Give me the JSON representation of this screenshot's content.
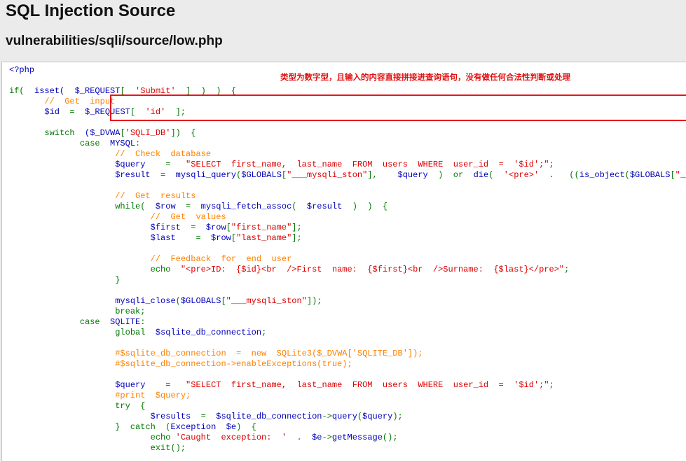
{
  "page": {
    "title": "SQL Injection Source",
    "subtitle": "vulnerabilities/sqli/source/low.php"
  },
  "annotation": {
    "text": "类型为数字型，且输入的内容直接拼接进查询语句，没有做任何合法性判断或处理",
    "color": "#e01010"
  },
  "highlight": {
    "border_color": "#e4151c"
  },
  "colors": {
    "default": "#0000bb",
    "string": "#dd0000",
    "keyword": "#007700",
    "comment": "#ff8000"
  },
  "code_lines": [
    [
      [
        "def",
        "<?php"
      ]
    ],
    [],
    [
      [
        "kw",
        "if( "
      ],
      [
        "def",
        " isset( "
      ],
      [
        "kw",
        " "
      ],
      [
        "def",
        "$_REQUEST"
      ],
      [
        "kw",
        "[ "
      ],
      [
        "str",
        " 'Submit' "
      ],
      [
        "kw",
        " ]  )  )  {"
      ]
    ],
    [
      [
        "cmt",
        "       //  Get  input"
      ]
    ],
    [
      [
        "def",
        "       $id "
      ],
      [
        "kw",
        " = "
      ],
      [
        "def",
        " $_REQUEST"
      ],
      [
        "kw",
        "[ "
      ],
      [
        "str",
        " 'id' "
      ],
      [
        "kw",
        " ];"
      ]
    ],
    [],
    [
      [
        "kw",
        "       switch "
      ],
      [
        "def",
        " ($_DVWA"
      ],
      [
        "kw",
        "["
      ],
      [
        "str",
        "'SQLI_DB'"
      ],
      [
        "kw",
        "]) "
      ],
      [
        "kw",
        " {"
      ]
    ],
    [
      [
        "kw",
        "              case "
      ],
      [
        "def",
        " MYSQL"
      ],
      [
        "kw",
        ":"
      ]
    ],
    [
      [
        "cmt",
        "                     //  Check  database"
      ]
    ],
    [
      [
        "def",
        "                     $query "
      ],
      [
        "kw",
        "   = "
      ],
      [
        "str",
        "  \"SELECT  first_name,  last_name  FROM  users  WHERE  user_id  =  '$id';\""
      ],
      [
        "kw",
        ";"
      ]
    ],
    [
      [
        "def",
        "                     $result "
      ],
      [
        "kw",
        " = "
      ],
      [
        "def",
        " mysqli_query"
      ],
      [
        "kw",
        "("
      ],
      [
        "def",
        "$GLOBALS"
      ],
      [
        "kw",
        "["
      ],
      [
        "str",
        "\"___mysqli_ston\""
      ],
      [
        "kw",
        "],    "
      ],
      [
        "def",
        "$query "
      ],
      [
        "kw",
        " ) "
      ],
      [
        "kw",
        " or "
      ],
      [
        "def",
        " die"
      ],
      [
        "kw",
        "( "
      ],
      [
        "str",
        " '<pre>' "
      ],
      [
        "kw",
        " . "
      ],
      [
        "kw",
        "  (("
      ],
      [
        "def",
        "is_object"
      ],
      [
        "kw",
        "("
      ],
      [
        "def",
        "$GLOBALS"
      ],
      [
        "kw",
        "["
      ],
      [
        "str",
        "\"___mysqli_ston\""
      ],
      [
        "kw",
        "]))"
      ]
    ],
    [],
    [
      [
        "cmt",
        "                     //  Get  results"
      ]
    ],
    [
      [
        "kw",
        "                     while( "
      ],
      [
        "def",
        " $row "
      ],
      [
        "kw",
        " = "
      ],
      [
        "def",
        " mysqli_fetch_assoc"
      ],
      [
        "kw",
        "( "
      ],
      [
        "def",
        " $result "
      ],
      [
        "kw",
        " )  )  {"
      ]
    ],
    [
      [
        "cmt",
        "                            //  Get  values"
      ]
    ],
    [
      [
        "def",
        "                            $first "
      ],
      [
        "kw",
        " = "
      ],
      [
        "def",
        " $row"
      ],
      [
        "kw",
        "["
      ],
      [
        "str",
        "\"first_name\""
      ],
      [
        "kw",
        "];"
      ]
    ],
    [
      [
        "def",
        "                            $last "
      ],
      [
        "kw",
        "   = "
      ],
      [
        "def",
        " $row"
      ],
      [
        "kw",
        "["
      ],
      [
        "str",
        "\"last_name\""
      ],
      [
        "kw",
        "];"
      ]
    ],
    [],
    [
      [
        "cmt",
        "                            //  Feedback  for  end  user"
      ]
    ],
    [
      [
        "kw",
        "                            echo "
      ],
      [
        "str",
        " \"<pre>ID:  {$id}<br  />First  name:  {$first}<br  />Surname:  {$last}</pre>\""
      ],
      [
        "kw",
        ";"
      ]
    ],
    [
      [
        "kw",
        "                     }"
      ]
    ],
    [],
    [
      [
        "def",
        "                     mysqli_close"
      ],
      [
        "kw",
        "("
      ],
      [
        "def",
        "$GLOBALS"
      ],
      [
        "kw",
        "["
      ],
      [
        "str",
        "\"___mysqli_ston\""
      ],
      [
        "kw",
        "]);"
      ]
    ],
    [
      [
        "kw",
        "                     break;"
      ]
    ],
    [
      [
        "kw",
        "              case "
      ],
      [
        "def",
        " SQLITE"
      ],
      [
        "kw",
        ":"
      ]
    ],
    [
      [
        "kw",
        "                     global "
      ],
      [
        "def",
        " $sqlite_db_connection"
      ],
      [
        "kw",
        ";"
      ]
    ],
    [],
    [
      [
        "cmt",
        "                     #$sqlite_db_connection  =  new  SQLite3($_DVWA['SQLITE_DB']);"
      ]
    ],
    [
      [
        "cmt",
        "                     #$sqlite_db_connection->enableExceptions(true);"
      ]
    ],
    [],
    [
      [
        "def",
        "                     $query "
      ],
      [
        "kw",
        "   = "
      ],
      [
        "str",
        "  \"SELECT  first_name,  last_name  FROM  users  WHERE  user_id  =  '$id';\""
      ],
      [
        "kw",
        ";"
      ]
    ],
    [
      [
        "cmt",
        "                     #print  $query;"
      ]
    ],
    [
      [
        "kw",
        "                     try "
      ],
      [
        "kw",
        " {"
      ]
    ],
    [
      [
        "def",
        "                            $results "
      ],
      [
        "kw",
        " = "
      ],
      [
        "def",
        " $sqlite_db_connection"
      ],
      [
        "kw",
        "->"
      ],
      [
        "def",
        "query"
      ],
      [
        "kw",
        "("
      ],
      [
        "def",
        "$query"
      ],
      [
        "kw",
        ");"
      ]
    ],
    [
      [
        "kw",
        "                     } "
      ],
      [
        "kw",
        " catch "
      ],
      [
        "kw",
        " ("
      ],
      [
        "def",
        "Exception "
      ],
      [
        "def",
        " $e"
      ],
      [
        "kw",
        ") "
      ],
      [
        "kw",
        " {"
      ]
    ],
    [
      [
        "kw",
        "                            echo "
      ],
      [
        "str",
        "'Caught  exception:  ' "
      ],
      [
        "kw",
        " . "
      ],
      [
        "def",
        " $e"
      ],
      [
        "kw",
        "->"
      ],
      [
        "def",
        "getMessage"
      ],
      [
        "kw",
        "();"
      ]
    ],
    [
      [
        "kw",
        "                            exit"
      ],
      [
        "kw",
        "();"
      ]
    ]
  ]
}
